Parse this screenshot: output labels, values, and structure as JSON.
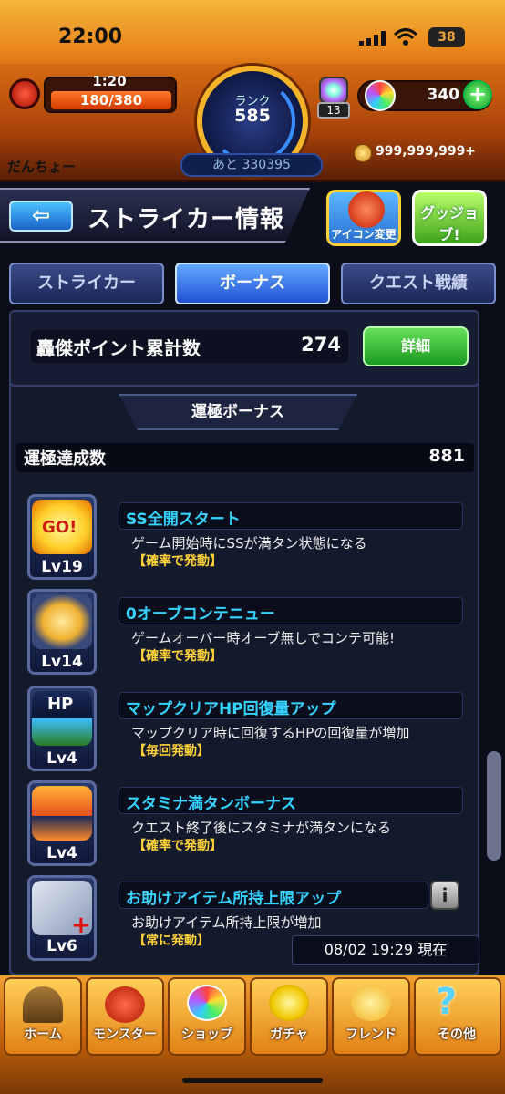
{
  "status_bar": {
    "time": "22:00",
    "battery": "38"
  },
  "header": {
    "stamina_time": "1:20",
    "stamina": "180/380",
    "rank_label": "ランク",
    "rank": "585",
    "next_exp": "あと 330395",
    "box_count": "13",
    "orbs": "340",
    "username": "だんちょー",
    "gold": "999,999,999+"
  },
  "title": {
    "page_title": "ストライカー情報",
    "icon_change_label": "アイコン変更",
    "goodjob_label": "グッジョブ!"
  },
  "tabs": [
    {
      "label": "ストライカー"
    },
    {
      "label": "ボーナス"
    },
    {
      "label": "クエスト戦績"
    }
  ],
  "goketsu": {
    "label": "轟傑ポイント累計数",
    "value": "274",
    "detail_label": "詳細"
  },
  "unkyoku": {
    "section_title": "運極ボーナス",
    "label": "運極達成数",
    "value": "881"
  },
  "bonuses": [
    {
      "name": "SS全開スタート",
      "desc": "ゲーム開始時にSSが満タン状態になる",
      "trigger": "【確率で発動】",
      "level": "Lv19",
      "icon": "go-icon"
    },
    {
      "name": "0オーブコンテニュー",
      "desc": "ゲームオーバー時オーブ無しでコンテ可能!",
      "trigger": "【確率で発動】",
      "level": "Lv14",
      "icon": "winged-arrow-icon"
    },
    {
      "name": "マップクリアHP回復量アップ",
      "desc": "マップクリア時に回復するHPの回復量が増加",
      "trigger": "【毎回発動】",
      "level": "Lv4",
      "icon": "hp-icon"
    },
    {
      "name": "スタミナ満タンボーナス",
      "desc": "クエスト終了後にスタミナが満タンになる",
      "trigger": "【確率で発動】",
      "level": "Lv4",
      "icon": "stamina-icon"
    },
    {
      "name": "お助けアイテム所持上限アップ",
      "desc": "お助けアイテム所持上限が増加",
      "trigger": "【常に発動】",
      "level": "Lv6",
      "icon": "item-plus-icon"
    }
  ],
  "datetime": "08/02 19:29 現在",
  "nav": [
    {
      "label": "ホーム",
      "icon": "home-icon"
    },
    {
      "label": "モンスター",
      "icon": "dragon-icon"
    },
    {
      "label": "ショップ",
      "icon": "orb-icon"
    },
    {
      "label": "ガチャ",
      "icon": "egg-icon"
    },
    {
      "label": "フレンド",
      "icon": "friends-icon"
    },
    {
      "label": "その他",
      "icon": "question-icon"
    }
  ],
  "colors": {
    "accent": "#f5b32a",
    "bonus_name": "#35d4ff",
    "trigger": "#ffd23a",
    "detail_button": "#1a9a20"
  }
}
